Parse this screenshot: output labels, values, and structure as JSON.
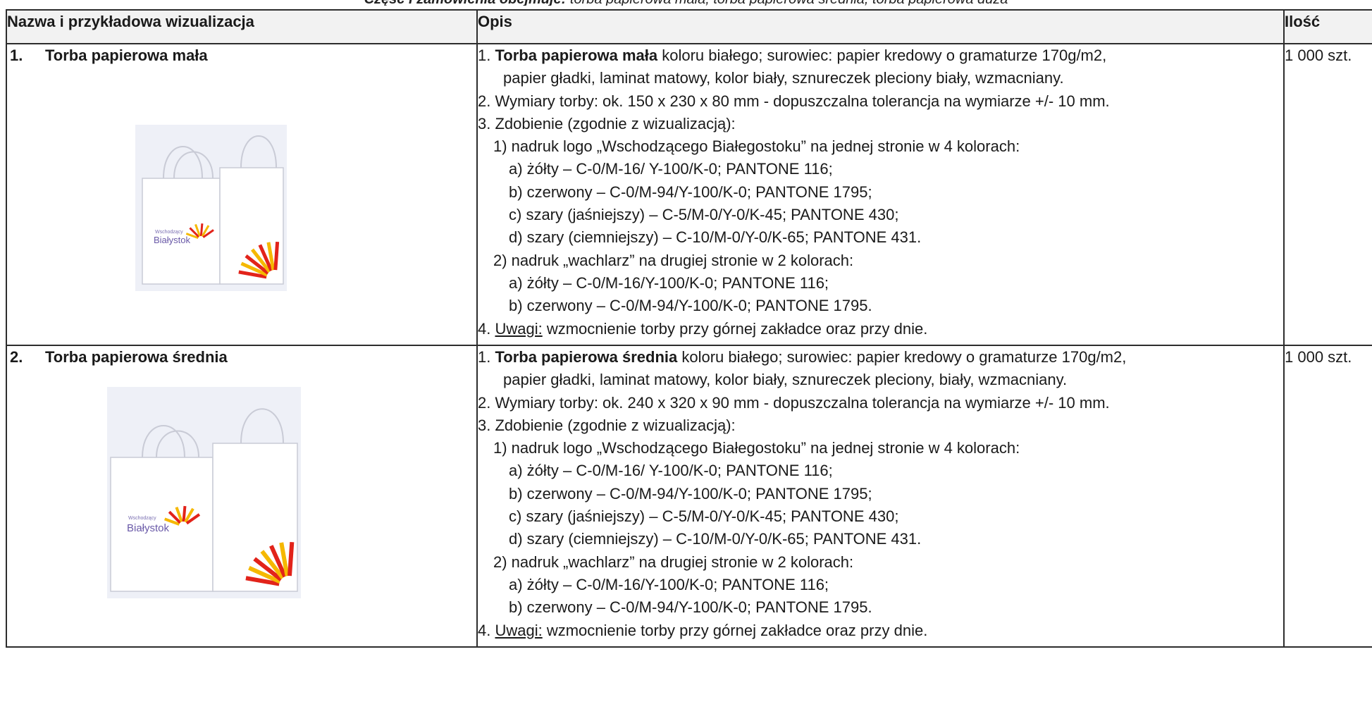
{
  "cut_header": {
    "bold": "Część I zamówienia obejmuje:",
    "rest": " torba papierowa mała, torba papierowa średnia, torba papierowa duża"
  },
  "table": {
    "headers": [
      "Nazwa i przykładowa wizualizacja",
      "Opis",
      "Ilość"
    ],
    "rows": [
      {
        "num": "1.",
        "name": "Torba papierowa mała",
        "qty": "1 000 szt.",
        "logo_text": "Białystok",
        "logo_small": "Wschodzący",
        "desc": [
          {
            "num": "1. ",
            "bold": "Torba papierowa mała",
            "text": " koloru białego; surowiec: papier kredowy o gramaturze 170g/m2,"
          },
          {
            "text": "papier gładki, laminat matowy, kolor biały, sznureczek pleciony biały, wzmacniany."
          },
          {
            "text": "2. Wymiary torby: ok. 150 x 230 x 80 mm - dopuszczalna tolerancja na wymiarze +/- 10 mm."
          },
          {
            "text": "3. Zdobienie (zgodnie z wizualizacją):"
          },
          {
            "text": "1) nadruk logo „Wschodzącego Białegostoku” na jednej stronie w 4 kolorach:"
          },
          {
            "text": "a) żółty – C-0/M-16/ Y-100/K-0; PANTONE 116;"
          },
          {
            "text": "b) czerwony – C-0/M-94/Y-100/K-0; PANTONE 1795;"
          },
          {
            "text": "c) szary (jaśniejszy) – C-5/M-0/Y-0/K-45; PANTONE 430;"
          },
          {
            "text": "d) szary (ciemniejszy) – C-10/M-0/Y-0/K-65; PANTONE 431."
          },
          {
            "text": "2) nadruk „wachlarz” na drugiej stronie w 2 kolorach:"
          },
          {
            "text": "a) żółty – C-0/M-16/Y-100/K-0; PANTONE 116;"
          },
          {
            "text": "b) czerwony – C-0/M-94/Y-100/K-0; PANTONE 1795."
          },
          {
            "prefix": "4. ",
            "underline": "Uwagi:",
            "text": " wzmocnienie torby przy górnej zakładce oraz przy dnie."
          }
        ]
      },
      {
        "num": "2.",
        "name": "Torba papierowa średnia",
        "qty": "1 000 szt.",
        "logo_text": "Białystok",
        "logo_small": "Wschodzący",
        "desc": [
          {
            "num": "1. ",
            "bold": "Torba papierowa średnia",
            "text": " koloru białego; surowiec: papier kredowy o gramaturze 170g/m2,"
          },
          {
            "text": "papier gładki, laminat matowy, kolor biały, sznureczek pleciony, biały, wzmacniany."
          },
          {
            "text": "2. Wymiary torby: ok. 240 x 320 x 90 mm - dopuszczalna tolerancja na wymiarze +/- 10 mm."
          },
          {
            "text": "3. Zdobienie (zgodnie z wizualizacją):"
          },
          {
            "text": "1) nadruk logo „Wschodzącego Białegostoku” na jednej stronie w 4 kolorach:"
          },
          {
            "text": "a) żółty – C-0/M-16/ Y-100/K-0; PANTONE 116;"
          },
          {
            "text": "b) czerwony – C-0/M-94/Y-100/K-0; PANTONE 1795;"
          },
          {
            "text": "c) szary (jaśniejszy) – C-5/M-0/Y-0/K-45; PANTONE 430;"
          },
          {
            "text": "d) szary (ciemniejszy) – C-10/M-0/Y-0/K-65; PANTONE 431."
          },
          {
            "text": "2) nadruk „wachlarz” na drugiej stronie w 2 kolorach:"
          },
          {
            "text": "a) żółty – C-0/M-16/Y-100/K-0; PANTONE 116;"
          },
          {
            "text": "b) czerwony – C-0/M-94/Y-100/K-0; PANTONE 1795."
          },
          {
            "prefix": "4. ",
            "underline": "Uwagi:",
            "text": " wzmocnienie torby przy górnej zakładce oraz przy dnie."
          }
        ]
      }
    ]
  },
  "colors": {
    "fan_yellow": "#f5b800",
    "fan_red": "#e2231a",
    "logo_purple": "#6a5aa8",
    "header_bg": "#f2f2f2"
  }
}
